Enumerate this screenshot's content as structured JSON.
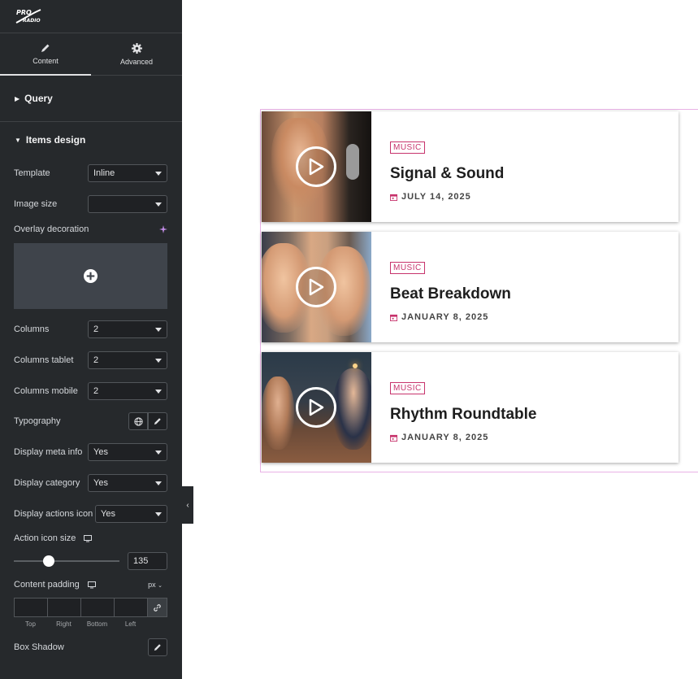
{
  "sidebar": {
    "logo_text": "PRO RADIO",
    "tabs": [
      {
        "label": "Content",
        "icon": "pencil-icon"
      },
      {
        "label": "Advanced",
        "icon": "gear-icon"
      }
    ],
    "sections": {
      "query": "Query",
      "items_design": "Items design"
    },
    "fields": {
      "template": {
        "label": "Template",
        "value": "Inline"
      },
      "image_size": {
        "label": "Image size",
        "value": ""
      },
      "overlay_decoration": {
        "label": "Overlay decoration"
      },
      "columns": {
        "label": "Columns",
        "value": "2"
      },
      "columns_tablet": {
        "label": "Columns tablet",
        "value": "2"
      },
      "columns_mobile": {
        "label": "Columns mobile",
        "value": "2"
      },
      "typography": {
        "label": "Typography"
      },
      "display_meta_info": {
        "label": "Display meta info",
        "value": "Yes"
      },
      "display_category": {
        "label": "Display category",
        "value": "Yes"
      },
      "display_actions_icon": {
        "label": "Display actions icon",
        "value": "Yes"
      },
      "action_icon_size": {
        "label": "Action icon size",
        "value": "135",
        "slider_fraction": 0.33
      },
      "content_padding": {
        "label": "Content padding",
        "unit": "px",
        "sides": [
          "Top",
          "Right",
          "Bottom",
          "Left"
        ]
      },
      "box_shadow": {
        "label": "Box Shadow"
      }
    }
  },
  "preview": {
    "cards": [
      {
        "category": "MUSIC",
        "title": "Signal & Sound",
        "date": "JULY 14, 2025"
      },
      {
        "category": "MUSIC",
        "title": "Beat Breakdown",
        "date": "JANUARY 8, 2025"
      },
      {
        "category": "MUSIC",
        "title": "Rhythm Roundtable",
        "date": "JANUARY 8, 2025"
      }
    ]
  },
  "colors": {
    "panel_bg": "#26292c",
    "accent": "#c7336c",
    "outline": "#e9b2e6"
  }
}
